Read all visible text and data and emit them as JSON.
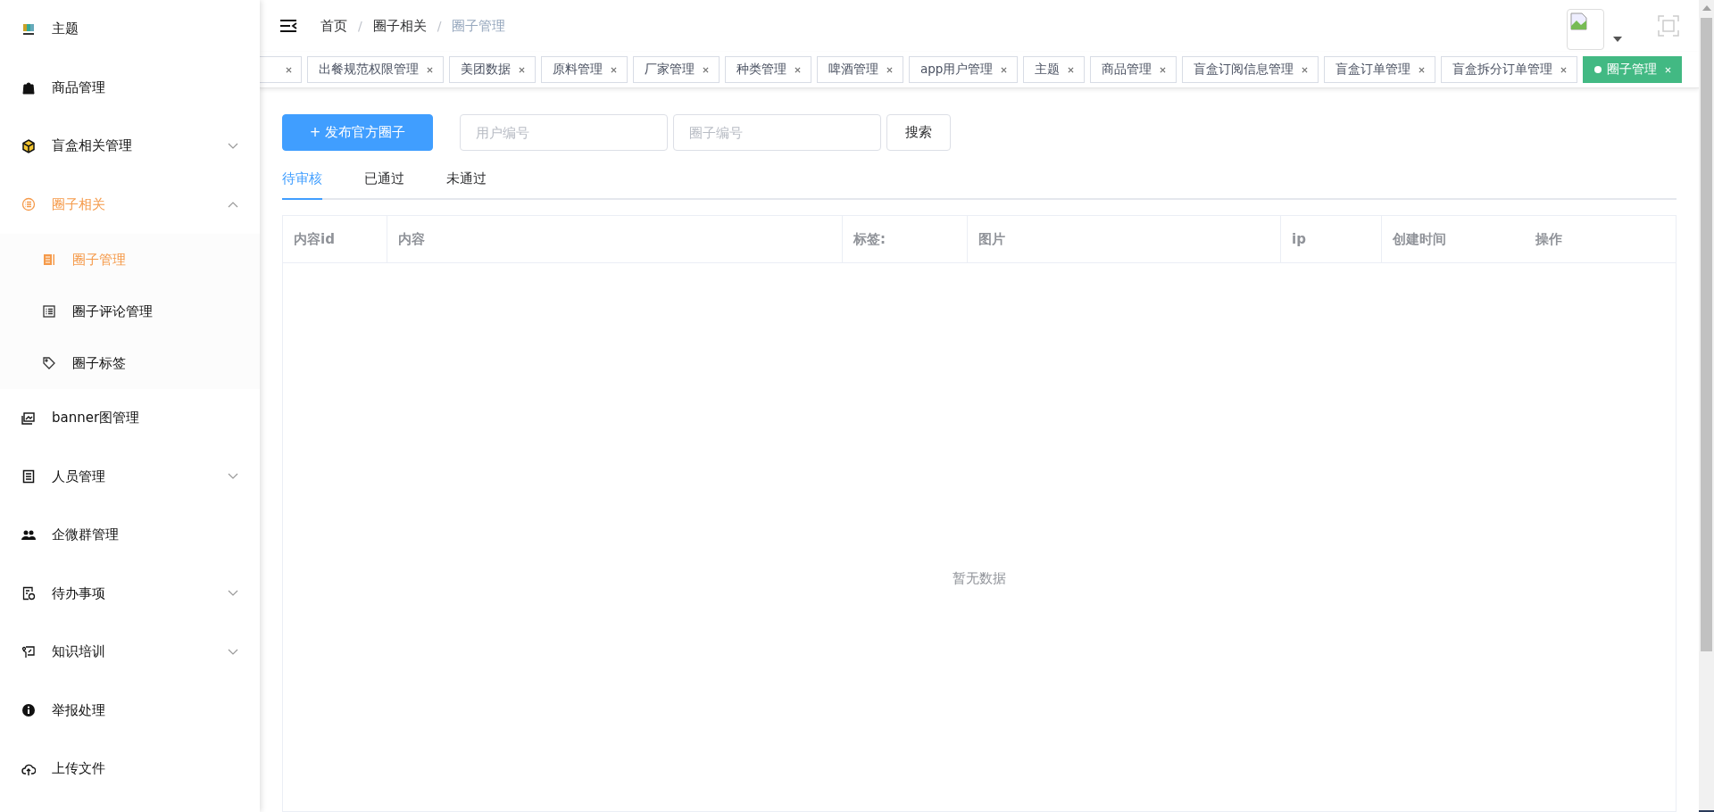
{
  "sidebar": {
    "items": [
      {
        "label": "主题",
        "selected": false
      },
      {
        "label": "商品管理",
        "selected": false
      },
      {
        "label": "盲盒相关管理",
        "selected": false,
        "expanded": false
      },
      {
        "label": "圈子相关",
        "selected": true,
        "expanded": true,
        "children": [
          {
            "label": "圈子管理",
            "selected": true
          },
          {
            "label": "圈子评论管理",
            "selected": false
          },
          {
            "label": "圈子标签",
            "selected": false
          }
        ]
      },
      {
        "label": "banner图管理",
        "selected": false
      },
      {
        "label": "人员管理",
        "selected": false,
        "expanded": false
      },
      {
        "label": "企微群管理",
        "selected": false
      },
      {
        "label": "待办事项",
        "selected": false,
        "expanded": false
      },
      {
        "label": "知识培训",
        "selected": false,
        "expanded": false
      },
      {
        "label": "举报处理",
        "selected": false
      },
      {
        "label": "上传文件",
        "selected": false
      }
    ]
  },
  "breadcrumb": [
    {
      "label": "首页"
    },
    {
      "separator": "/",
      "label": "圈子相关"
    },
    {
      "separator": "/",
      "label": "圈子管理"
    }
  ],
  "tags": [
    {
      "selected": false
    },
    {
      "label": "出餐规范权限管理",
      "selected": false
    },
    {
      "label": "美团数据",
      "selected": false
    },
    {
      "label": "原料管理",
      "selected": false
    },
    {
      "label": "厂家管理",
      "selected": false
    },
    {
      "label": "种类管理",
      "selected": false
    },
    {
      "label": "啤酒管理",
      "selected": false
    },
    {
      "label": "app用户管理",
      "selected": false
    },
    {
      "label": "主题",
      "selected": false
    },
    {
      "label": "商品管理",
      "selected": false
    },
    {
      "label": "盲盒订阅信息管理",
      "selected": false
    },
    {
      "label": "盲盒订单管理",
      "selected": false
    },
    {
      "label": "盲盒拆分订单管理",
      "selected": false
    },
    {
      "label": "圈子管理",
      "selected": true
    }
  ],
  "toolbar": {
    "publish_button": "+ 发布官方圈子",
    "user_field": {
      "placeholder": "用户编号"
    },
    "circle_field": {
      "placeholder": "圈子编号"
    },
    "search_button": "搜索"
  },
  "tabs": [
    {
      "label": "待审核",
      "selected": true
    },
    {
      "label": "已通过",
      "selected": false
    },
    {
      "label": "未通过",
      "selected": false
    }
  ],
  "table": {
    "columns": [
      "内容id",
      "内容",
      "标签:",
      "图片",
      "ip",
      "创建时间",
      "操作"
    ],
    "empty_text": "暂无数据"
  }
}
